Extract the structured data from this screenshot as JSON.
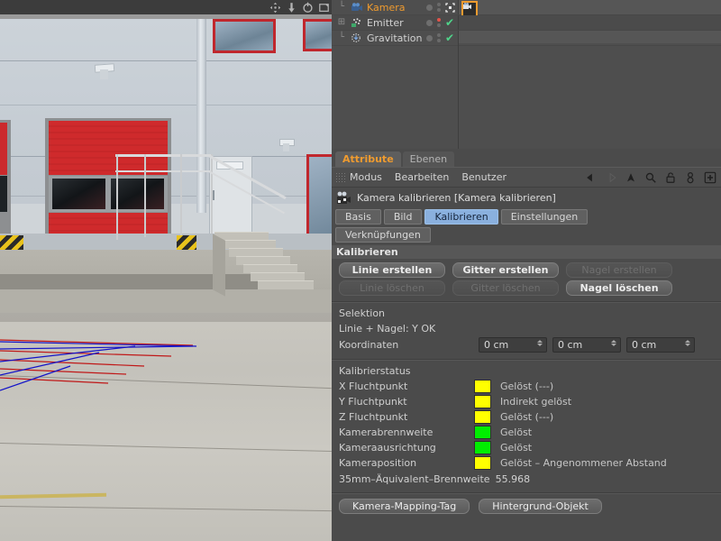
{
  "viewport": {
    "nav_icons": [
      "pan-icon",
      "dolly-icon",
      "rotate-icon",
      "maximize-icon"
    ],
    "scene_description": "Industrial warehouse facade with red roller door, concrete loading dock, stairs and handrail",
    "calibration_overlay": {
      "red_line_color": "#c01818",
      "blue_line_color": "#1414c8",
      "red_line_count": 5,
      "blue_line_count": 5
    }
  },
  "object_manager": {
    "rows": [
      {
        "label": "Kamera",
        "icon": "camera-icon",
        "selected": true,
        "expander": "",
        "indent": 1,
        "visdot_red": false,
        "tag_icon": "camera-calibrator-tag",
        "tag_selected": true,
        "marker": "target-icon"
      },
      {
        "label": "Emitter",
        "icon": "emitter-icon",
        "selected": false,
        "expander": "+",
        "indent": 0,
        "visdot_red": true,
        "tag_icon": "",
        "tag_selected": false,
        "marker": "check-icon"
      },
      {
        "label": "Gravitation",
        "icon": "gravitation-icon",
        "selected": false,
        "expander": "",
        "indent": 1,
        "visdot_red": false,
        "tag_icon": "",
        "tag_selected": false,
        "marker": "check-icon"
      }
    ]
  },
  "attribute_manager": {
    "panel_tabs": [
      {
        "label": "Attribute",
        "active": true
      },
      {
        "label": "Ebenen",
        "active": false
      }
    ],
    "menu_items": [
      "Modus",
      "Bearbeiten",
      "Benutzer"
    ],
    "tool_icons": [
      "back-arrow-icon",
      "forward-arrow-icon",
      "up-arrow-icon",
      "search-icon",
      "unlock-icon",
      "person-icon",
      "add-box-icon"
    ],
    "object_title": "Kamera kalibrieren [Kamera kalibrieren]",
    "object_icon": "camera-calibrator-icon",
    "sub_tabs": [
      {
        "label": "Basis",
        "active": false
      },
      {
        "label": "Bild",
        "active": false
      },
      {
        "label": "Kalibrieren",
        "active": true
      },
      {
        "label": "Einstellungen",
        "active": false
      },
      {
        "label": "Verknüpfungen",
        "active": false
      }
    ],
    "section_calibrate": {
      "header": "Kalibrieren",
      "buttons": [
        {
          "label": "Linie erstellen",
          "enabled": true
        },
        {
          "label": "Gitter erstellen",
          "enabled": true
        },
        {
          "label": "Nagel erstellen",
          "enabled": false
        },
        {
          "label": "Linie löschen",
          "enabled": false
        },
        {
          "label": "Gitter löschen",
          "enabled": false
        },
        {
          "label": "Nagel löschen",
          "enabled": true
        }
      ]
    },
    "section_selection": {
      "header": "Selektion",
      "status_text": "Linie + Nagel: Y OK",
      "coordinates_label": "Koordinaten",
      "coordinates": [
        "0 cm",
        "0 cm",
        "0 cm"
      ]
    },
    "section_status": {
      "header": "Kalibrierstatus",
      "rows": [
        {
          "name": "X Fluchtpunkt",
          "color": "#FFFF00",
          "value": "Gelöst (---)"
        },
        {
          "name": "Y Fluchtpunkt",
          "color": "#FFFF00",
          "value": "Indirekt gelöst"
        },
        {
          "name": "Z Fluchtpunkt",
          "color": "#FFFF00",
          "value": "Gelöst (---)"
        },
        {
          "name": "Kamerabrennweite",
          "color": "#00EE00",
          "value": "Gelöst"
        },
        {
          "name": "Kameraausrichtung",
          "color": "#00EE00",
          "value": "Gelöst"
        },
        {
          "name": "Kameraposition",
          "color": "#FFFF00",
          "value": "Gelöst – Angenommener Abstand"
        }
      ],
      "focal_label": "35mm–Äquivalent–Brennweite",
      "focal_value": "55.968"
    },
    "bottom_buttons": [
      {
        "label": "Kamera-Mapping-Tag"
      },
      {
        "label": "Hintergrund-Objekt"
      }
    ]
  },
  "colors": {
    "accent_orange": "#ef9b2f",
    "tab_active_blue": "#8ab0de",
    "status_yellow": "#FFFF00",
    "status_green": "#00EE00",
    "panel_bg": "#4b4b4b"
  }
}
